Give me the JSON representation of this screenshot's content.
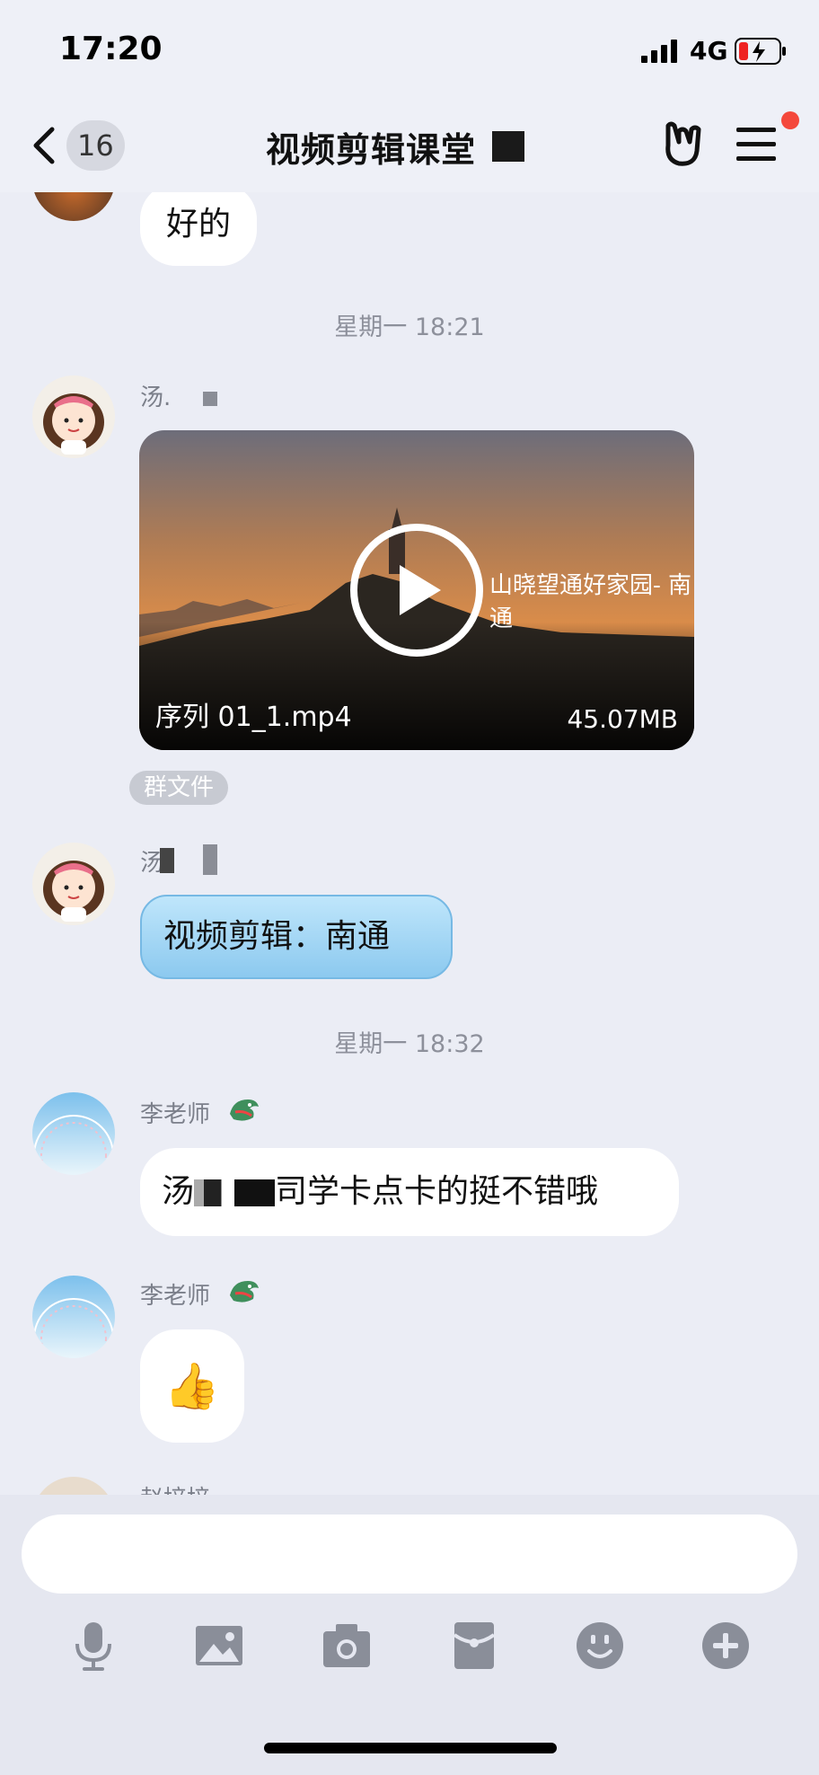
{
  "status_bar": {
    "time": "17:20",
    "network": "4G"
  },
  "nav": {
    "back_count": "16",
    "title": "视频剪辑课堂"
  },
  "messages": {
    "m1_text": "好的",
    "ts1": "星期一 18:21",
    "m2_sender": "汤.",
    "video": {
      "filename": "序列 01_1.mp4",
      "size": "45.07MB",
      "overlay_text": "山晓望通好家园- 南通"
    },
    "file_tag": "群文件",
    "m3_sender": "汤.",
    "m3_text": "视频剪辑：南通",
    "ts2": "星期一 18:32",
    "m4_sender": "李老师",
    "m4_text_a": "汤",
    "m4_text_b": "司学卡点卡的挺不错哦",
    "m5_sender": "李老师",
    "m5_emoji": "👍",
    "m6_sender_partial": "赵培培"
  },
  "colors": {
    "accent_red": "#f4483b",
    "bubble_blue": "#a9d9f6",
    "background": "#ebedf5"
  },
  "icons": [
    "back-chevron-icon",
    "hand-gesture-icon",
    "menu-icon",
    "microphone-icon",
    "image-icon",
    "camera-icon",
    "red-packet-icon",
    "emoji-icon",
    "plus-icon"
  ]
}
